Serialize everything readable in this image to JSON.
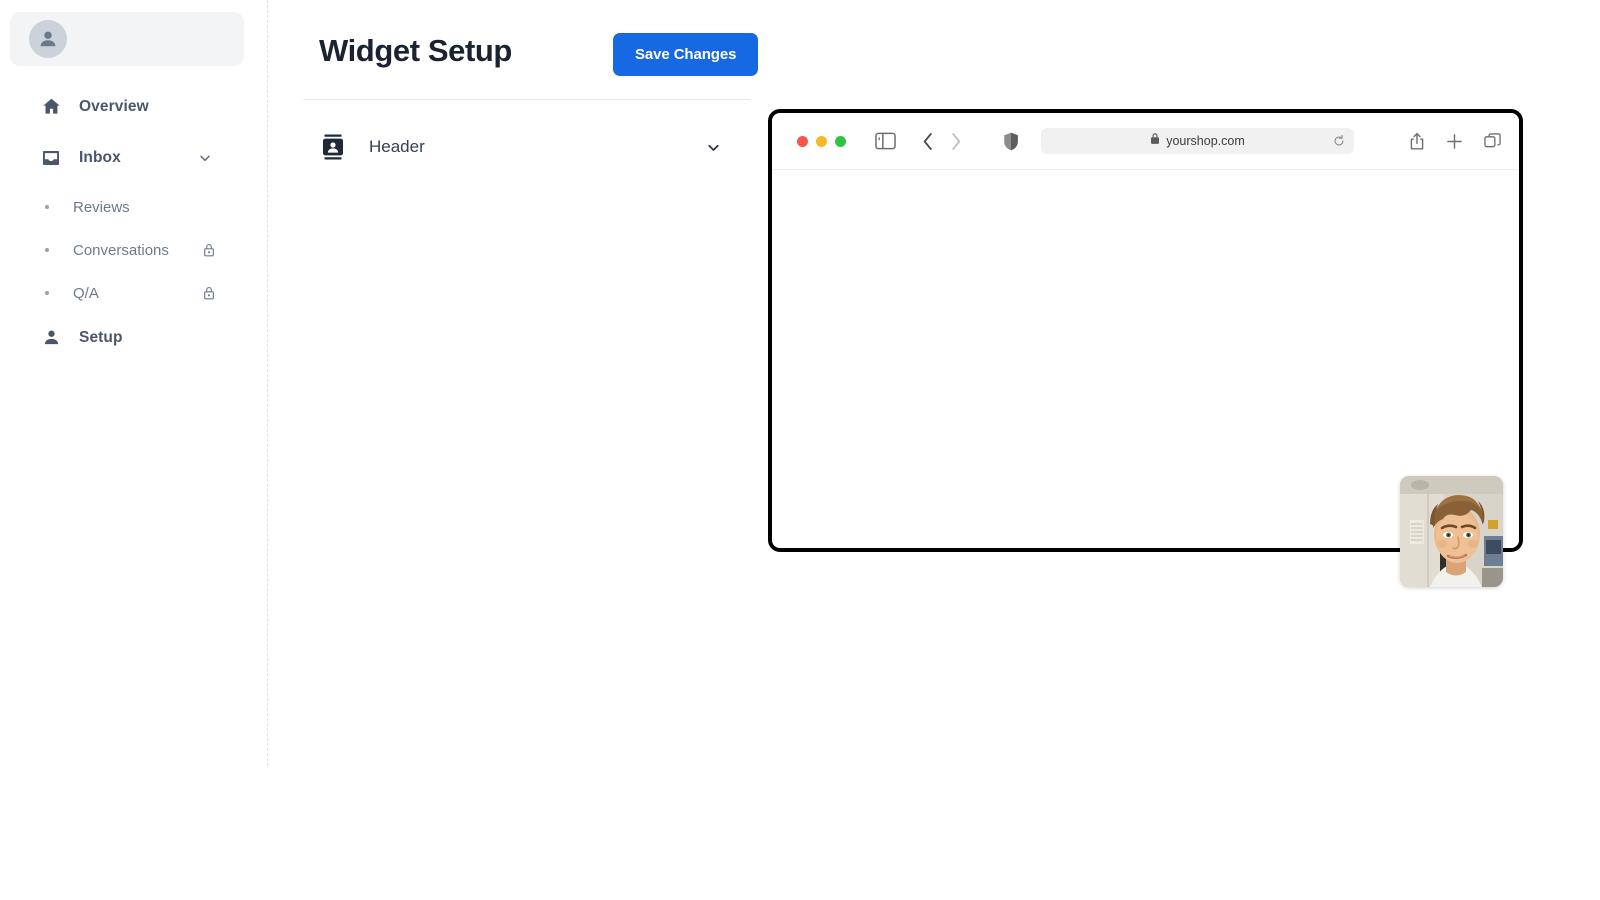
{
  "sidebar": {
    "account": {
      "name": "account-switcher",
      "avatar_icon": "person-avatar-icon"
    },
    "items": [
      {
        "label": "Overview",
        "icon": "home-icon",
        "type": "nav",
        "has_chevron": false
      },
      {
        "label": "Inbox",
        "icon": "inbox-icon",
        "type": "nav",
        "has_chevron": true,
        "chevron_icon": "chevron-down-icon"
      },
      {
        "label": "Reviews",
        "icon": "bullet-dot",
        "type": "sub",
        "locked": false
      },
      {
        "label": "Conversations",
        "icon": "bullet-dot",
        "type": "sub",
        "locked": true,
        "lock_icon": "lock-icon"
      },
      {
        "label": "Q/A",
        "icon": "bullet-dot",
        "type": "sub",
        "locked": true,
        "lock_icon": "lock-icon"
      },
      {
        "label": "Setup",
        "icon": "person-icon",
        "type": "nav",
        "has_chevron": false
      }
    ]
  },
  "main": {
    "page_title": "Widget Setup",
    "save_label": "Save Changes",
    "accordion": {
      "label": "Header",
      "icon": "contact-card-icon",
      "chevron_icon": "chevron-down-icon",
      "expanded": false
    }
  },
  "browser_preview": {
    "traffic_lights": [
      "close-red",
      "minimize-yellow",
      "zoom-green"
    ],
    "toolbar_icons": [
      "sidebar-toggle-icon",
      "back-chevron-icon",
      "forward-chevron-icon",
      "shield-privacy-icon",
      "share-icon",
      "new-tab-plus-icon",
      "tab-overview-icon"
    ],
    "url": "yourshop.com",
    "url_lock_icon": "lock-icon",
    "url_reload_icon": "reload-icon",
    "video_thumbnail": "webcam-video-thumbnail"
  },
  "colors": {
    "accent_blue": "#1668e3",
    "sidebar_label": "#4b5768",
    "sub_label": "#6e7a8a",
    "title": "#1b2330",
    "light_red": "#f9564b",
    "light_yellow": "#f7b928",
    "light_green": "#2fc440",
    "browser_border": "#000000"
  }
}
